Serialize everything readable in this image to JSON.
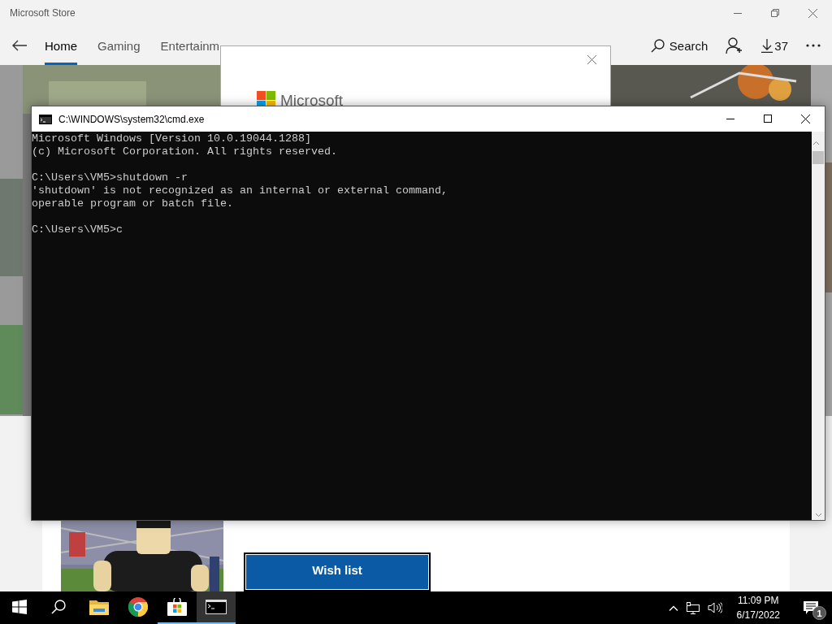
{
  "store": {
    "title": "Microsoft Store",
    "nav_tabs": [
      {
        "label": "Home",
        "selected": true
      },
      {
        "label": "Gaming",
        "selected": false
      },
      {
        "label": "Entertainm",
        "selected": false
      }
    ],
    "search": "Search",
    "downloads": "37",
    "card": {
      "button": "Wish list"
    }
  },
  "dialog": {
    "brand": "Microsoft"
  },
  "cmd": {
    "title": "C:\\WINDOWS\\system32\\cmd.exe",
    "output": [
      [
        "Microsoft Windows [Version 10.0.19044.1288]",
        "(c) Microsoft Corporation. All rights reserved."
      ],
      [
        "C:\\Users\\VM5>shutdown -r",
        "'shutdown' is not recognized as an internal or external command,",
        "operable program or batch file."
      ],
      [
        "C:\\Users\\VM5>c"
      ]
    ]
  },
  "taskbar": {
    "apps": [
      {
        "kind": "explorer",
        "running": false,
        "selected": false
      },
      {
        "kind": "chrome",
        "running": false,
        "selected": false
      },
      {
        "kind": "store",
        "running": true,
        "selected": false
      },
      {
        "kind": "cmd",
        "running": true,
        "selected": true
      }
    ],
    "time": "11:09 PM",
    "date": "6/17/2022",
    "notifications": "1"
  }
}
